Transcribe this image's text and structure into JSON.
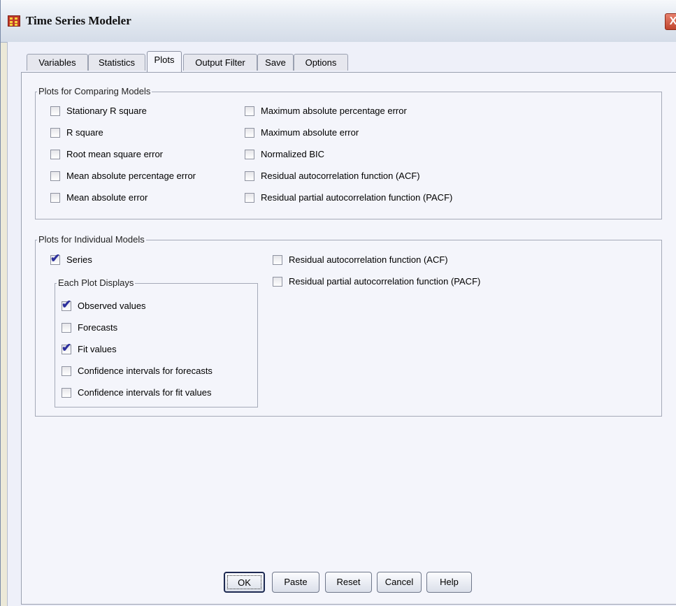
{
  "window": {
    "title": "Time Series Modeler",
    "close_label": "X"
  },
  "tabs": [
    {
      "label": "Variables"
    },
    {
      "label": "Statistics"
    },
    {
      "label": "Plots"
    },
    {
      "label": "Output Filter"
    },
    {
      "label": "Save"
    },
    {
      "label": "Options"
    }
  ],
  "active_tab": "Plots",
  "comparing": {
    "legend": "Plots for Comparing Models",
    "left": [
      {
        "label": "Stationary R square",
        "checked": false
      },
      {
        "label": "R square",
        "checked": false
      },
      {
        "label": "Root mean square error",
        "checked": false
      },
      {
        "label": "Mean absolute percentage error",
        "checked": false
      },
      {
        "label": "Mean absolute error",
        "checked": false
      }
    ],
    "right": [
      {
        "label": "Maximum absolute percentage error",
        "checked": false
      },
      {
        "label": "Maximum absolute error",
        "checked": false
      },
      {
        "label": "Normalized BIC",
        "checked": false
      },
      {
        "label": "Residual autocorrelation function (ACF)",
        "checked": false
      },
      {
        "label": "Residual partial autocorrelation function (PACF)",
        "checked": false
      }
    ]
  },
  "individual": {
    "legend": "Plots for Individual Models",
    "series": {
      "label": "Series",
      "checked": true
    },
    "displays_legend": "Each Plot Displays",
    "displays": [
      {
        "label": "Observed values",
        "checked": true
      },
      {
        "label": "Forecasts",
        "checked": false
      },
      {
        "label": "Fit values",
        "checked": true
      },
      {
        "label": "Confidence intervals for forecasts",
        "checked": false
      },
      {
        "label": "Confidence intervals for fit values",
        "checked": false
      }
    ],
    "right": [
      {
        "label": "Residual autocorrelation function (ACF)",
        "checked": false
      },
      {
        "label": "Residual partial autocorrelation function (PACF)",
        "checked": false
      }
    ]
  },
  "buttons": {
    "ok": "OK",
    "paste": "Paste",
    "reset": "Reset",
    "cancel": "Cancel",
    "help": "Help"
  },
  "colors": {
    "dialog_background": "#eef0f9",
    "checkmark": "#2c2f9c",
    "close_button": "#c0442c"
  }
}
